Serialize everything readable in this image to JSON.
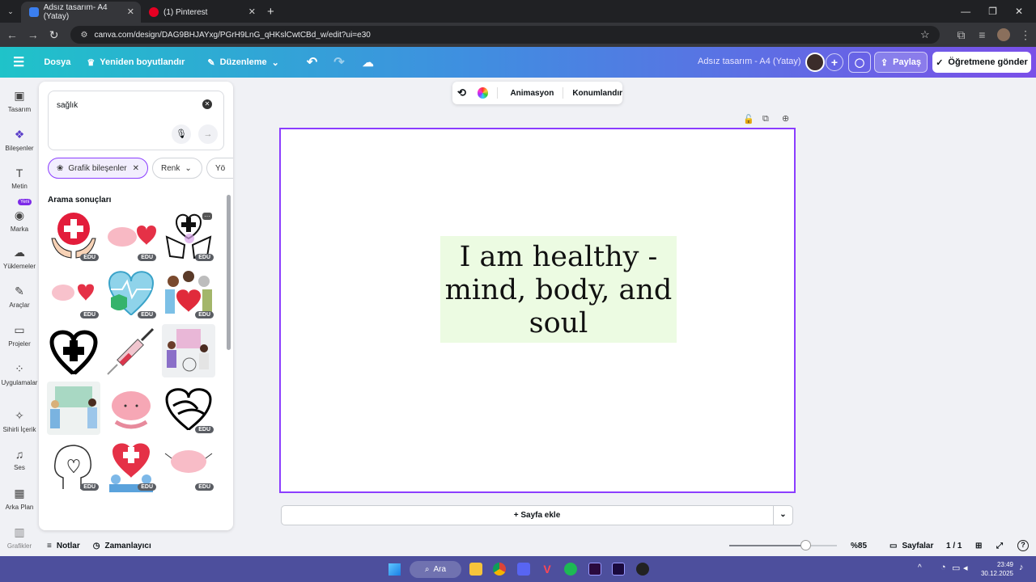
{
  "browser": {
    "tabs": [
      {
        "title": "Adsız tasarım- A4 (Yatay)"
      },
      {
        "title": "(1) Pinterest"
      }
    ],
    "url": "canva.com/design/DAG9BHJAYxg/PGrH9LnG_qHKslCwtCBd_w/edit?ui=e30"
  },
  "topbar": {
    "file": "Dosya",
    "resize": "Yeniden boyutlandır",
    "edit": "Düzenleme",
    "doc_title": "Adsız tasarım - A4 (Yatay)",
    "share": "Paylaş",
    "send_teacher": "Öğretmene gönder"
  },
  "rail": [
    {
      "label": "Tasarım",
      "icon": "layout-icon"
    },
    {
      "label": "Bileşenler",
      "icon": "elements-icon"
    },
    {
      "label": "Metin",
      "icon": "text-icon"
    },
    {
      "label": "Marka",
      "icon": "brand-icon",
      "badge": "Yeni"
    },
    {
      "label": "Yüklemeler",
      "icon": "upload-icon"
    },
    {
      "label": "Araçlar",
      "icon": "tools-icon"
    },
    {
      "label": "Projeler",
      "icon": "folder-icon"
    },
    {
      "label": "Uygulamalar",
      "icon": "apps-icon"
    },
    {
      "label": "Sihirli İçerik",
      "icon": "magic-icon"
    },
    {
      "label": "Ses",
      "icon": "music-icon"
    },
    {
      "label": "Arka Plan",
      "icon": "background-icon"
    },
    {
      "label": "Grafikler",
      "icon": "charts-icon"
    }
  ],
  "panel": {
    "search_value": "sağlık",
    "chips": [
      "Grafik bileşenler",
      "Renk",
      "Yö"
    ],
    "results_heading": "Arama sonuçları",
    "edu_badge": "EDU"
  },
  "context_bar": {
    "animation": "Animasyon",
    "position": "Konumlandır"
  },
  "canvas": {
    "quote_line1": "I am healthy -",
    "quote_line2": "mind, body, and",
    "quote_line3": "soul",
    "quote_bg": "#ecfbe2",
    "page_border": "#8b3dff"
  },
  "add_page": "+ Sayfa ekle",
  "bottom": {
    "notes": "Notlar",
    "timer": "Zamanlayıcı",
    "zoom": "%85",
    "zoom_level": 85,
    "pages": "Sayfalar",
    "page_count": "1 / 1"
  },
  "taskbar": {
    "search": "Ara",
    "time": "23:49",
    "date": "30.12.2025"
  }
}
